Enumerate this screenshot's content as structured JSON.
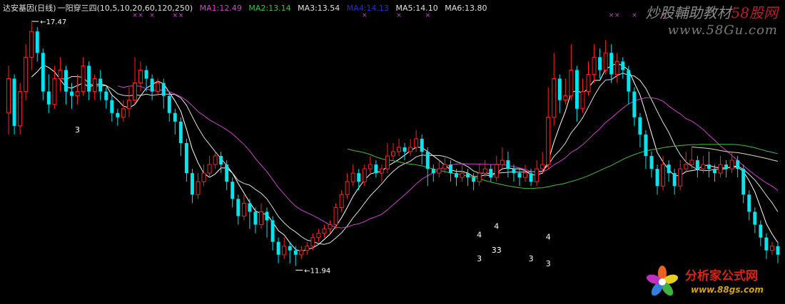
{
  "header": {
    "title": "达安基因(日线)",
    "formula": "一阳穿三四(10,5,10,20,60,120,250)",
    "ma": [
      {
        "label": "MA1:12.49",
        "color": "#d040d0"
      },
      {
        "label": "MA2:13.14",
        "color": "#40c040"
      },
      {
        "label": "MA3:13.54",
        "color": "#e0e0e0"
      },
      {
        "label": "MA4:14.13",
        "color": "#2a2ae0"
      },
      {
        "label": "MA5:14.10",
        "color": "#e0e0e0"
      },
      {
        "label": "MA6:13.80",
        "color": "#e0e0e0"
      }
    ]
  },
  "watermark": {
    "line1_text": "炒股輔助教材",
    "line1_num": "58股网",
    "line2": "www.58Gu.com"
  },
  "logo": {
    "text": "分析家公式网",
    "url": "www.88gs.com"
  },
  "chart_data": {
    "type": "candlestick",
    "title": "达安基因(日线)",
    "ylim": [
      11.5,
      17.8
    ],
    "colors": {
      "up": "#ff2020",
      "down": "#00e5ee",
      "signal": "#d040d0",
      "marker": "#ffffff"
    },
    "annotations": [
      {
        "label": "17.47",
        "candle": 4
      },
      {
        "label": "11.94",
        "candle": 50
      }
    ],
    "signals": [
      22,
      23,
      25,
      29,
      30,
      62,
      68,
      73,
      105,
      106,
      109,
      114
    ],
    "text_markers": [
      {
        "text": "3",
        "candle": 12,
        "price": 15.05
      },
      {
        "text": "4",
        "candle": 82,
        "price": 12.6
      },
      {
        "text": "3",
        "candle": 82,
        "price": 12.05
      },
      {
        "text": "4",
        "candle": 85,
        "price": 12.8
      },
      {
        "text": "33",
        "candle": 85,
        "price": 12.25
      },
      {
        "text": "3",
        "candle": 91,
        "price": 12.05
      },
      {
        "text": "4",
        "candle": 94,
        "price": 12.55
      },
      {
        "text": "3",
        "candle": 94,
        "price": 11.93
      }
    ],
    "candles": [
      [
        15.5,
        16.3,
        16.6,
        15.0
      ],
      [
        16.3,
        15.2,
        16.4,
        15.0
      ],
      [
        15.2,
        16.0,
        16.2,
        15.0
      ],
      [
        16.0,
        16.8,
        17.1,
        15.8
      ],
      [
        16.8,
        17.4,
        17.6,
        16.5
      ],
      [
        17.4,
        16.9,
        17.5,
        16.7
      ],
      [
        16.9,
        16.0,
        17.0,
        15.8
      ],
      [
        16.0,
        15.7,
        16.4,
        15.5
      ],
      [
        15.7,
        16.3,
        16.6,
        15.6
      ],
      [
        16.3,
        16.5,
        16.8,
        16.0
      ],
      [
        16.5,
        16.0,
        16.6,
        15.7
      ],
      [
        16.0,
        15.9,
        16.2,
        15.6
      ],
      [
        15.9,
        16.0,
        16.4,
        15.7
      ],
      [
        16.0,
        16.6,
        16.8,
        15.9
      ],
      [
        16.6,
        16.0,
        16.7,
        15.8
      ],
      [
        16.0,
        16.3,
        16.4,
        15.8
      ],
      [
        16.3,
        16.0,
        16.5,
        15.8
      ],
      [
        16.0,
        15.8,
        16.1,
        15.6
      ],
      [
        15.8,
        15.5,
        15.9,
        15.3
      ],
      [
        15.5,
        15.4,
        15.6,
        15.2
      ],
      [
        15.4,
        15.6,
        15.8,
        15.3
      ],
      [
        15.6,
        15.8,
        16.1,
        15.4
      ],
      [
        15.8,
        16.2,
        16.8,
        15.7
      ],
      [
        16.2,
        16.5,
        16.7,
        16.0
      ],
      [
        16.5,
        16.3,
        16.6,
        16.0
      ],
      [
        16.3,
        16.0,
        16.4,
        15.8
      ],
      [
        16.0,
        16.2,
        16.3,
        15.9
      ],
      [
        16.2,
        15.9,
        16.3,
        15.6
      ],
      [
        15.9,
        15.5,
        16.0,
        15.3
      ],
      [
        15.5,
        15.3,
        15.6,
        15.0
      ],
      [
        15.3,
        14.8,
        15.4,
        14.5
      ],
      [
        14.8,
        14.1,
        14.9,
        13.9
      ],
      [
        14.1,
        13.6,
        14.2,
        13.4
      ],
      [
        13.6,
        13.9,
        14.1,
        13.5
      ],
      [
        13.9,
        14.1,
        14.3,
        13.8
      ],
      [
        14.1,
        14.3,
        14.5,
        14.0
      ],
      [
        14.3,
        14.5,
        14.6,
        14.2
      ],
      [
        14.5,
        14.3,
        14.6,
        14.1
      ],
      [
        14.3,
        13.9,
        14.4,
        13.7
      ],
      [
        13.9,
        13.5,
        14.0,
        13.3
      ],
      [
        13.5,
        13.1,
        13.6,
        12.9
      ],
      [
        13.1,
        13.4,
        13.6,
        13.0
      ],
      [
        13.4,
        13.2,
        13.5,
        12.8
      ],
      [
        13.2,
        12.9,
        13.3,
        12.7
      ],
      [
        12.9,
        13.2,
        13.4,
        12.8
      ],
      [
        13.2,
        13.0,
        13.3,
        12.6
      ],
      [
        13.0,
        12.5,
        13.1,
        12.3
      ],
      [
        12.5,
        12.2,
        12.6,
        12.0
      ],
      [
        12.2,
        12.4,
        12.6,
        12.1
      ],
      [
        12.4,
        12.3,
        12.5,
        12.0
      ],
      [
        12.3,
        12.2,
        12.4,
        11.94
      ],
      [
        12.2,
        12.3,
        12.4,
        12.1
      ],
      [
        12.3,
        12.4,
        12.5,
        12.2
      ],
      [
        12.4,
        12.6,
        12.7,
        12.3
      ],
      [
        12.6,
        12.7,
        12.8,
        12.5
      ],
      [
        12.7,
        12.8,
        12.9,
        12.6
      ],
      [
        12.8,
        12.9,
        13.0,
        12.7
      ],
      [
        12.9,
        13.3,
        13.4,
        12.8
      ],
      [
        13.3,
        13.6,
        13.7,
        13.2
      ],
      [
        13.6,
        13.9,
        14.1,
        13.5
      ],
      [
        13.9,
        14.1,
        14.3,
        13.8
      ],
      [
        14.1,
        13.9,
        14.2,
        13.7
      ],
      [
        13.9,
        14.2,
        14.3,
        13.8
      ],
      [
        14.2,
        14.3,
        14.5,
        14.1
      ],
      [
        14.3,
        14.1,
        14.4,
        14.0
      ],
      [
        14.1,
        14.2,
        14.3,
        13.9
      ],
      [
        14.2,
        14.5,
        14.8,
        14.1
      ],
      [
        14.5,
        14.6,
        14.8,
        14.4
      ],
      [
        14.6,
        14.7,
        14.9,
        14.5
      ],
      [
        14.7,
        14.6,
        14.8,
        14.4
      ],
      [
        14.6,
        14.7,
        14.9,
        14.5
      ],
      [
        14.7,
        14.9,
        15.1,
        14.6
      ],
      [
        14.9,
        14.6,
        15.0,
        14.3
      ],
      [
        14.6,
        14.2,
        14.7,
        13.8
      ],
      [
        14.2,
        14.1,
        14.3,
        13.9
      ],
      [
        14.1,
        14.2,
        14.4,
        14.0
      ],
      [
        14.2,
        14.3,
        14.5,
        14.1
      ],
      [
        14.3,
        14.1,
        14.4,
        13.9
      ],
      [
        14.1,
        14.0,
        14.2,
        13.8
      ],
      [
        14.0,
        14.1,
        14.3,
        13.9
      ],
      [
        14.1,
        14.0,
        14.2,
        13.8
      ],
      [
        14.0,
        13.9,
        14.1,
        13.7
      ],
      [
        13.9,
        14.1,
        14.3,
        13.8
      ],
      [
        14.1,
        14.2,
        14.4,
        14.0
      ],
      [
        14.2,
        14.0,
        14.3,
        13.9
      ],
      [
        14.0,
        14.3,
        14.5,
        13.9
      ],
      [
        14.3,
        14.4,
        14.7,
        14.2
      ],
      [
        14.4,
        14.2,
        14.6,
        14.0
      ],
      [
        14.2,
        14.1,
        14.3,
        13.9
      ],
      [
        14.1,
        14.0,
        14.2,
        13.8
      ],
      [
        14.0,
        14.1,
        14.3,
        13.9
      ],
      [
        14.1,
        13.9,
        14.2,
        13.8
      ],
      [
        13.9,
        14.2,
        14.4,
        13.8
      ],
      [
        14.2,
        14.3,
        14.6,
        14.1
      ],
      [
        14.3,
        15.4,
        16.1,
        14.2
      ],
      [
        15.4,
        16.3,
        16.9,
        15.2
      ],
      [
        16.3,
        15.8,
        16.4,
        15.5
      ],
      [
        15.8,
        15.9,
        16.3,
        15.7
      ],
      [
        15.9,
        16.5,
        17.1,
        15.8
      ],
      [
        16.5,
        15.6,
        16.6,
        15.3
      ],
      [
        15.6,
        16.0,
        16.3,
        15.5
      ],
      [
        16.0,
        16.4,
        16.7,
        15.9
      ],
      [
        16.4,
        16.8,
        17.1,
        16.2
      ],
      [
        16.8,
        16.5,
        17.0,
        16.3
      ],
      [
        16.5,
        16.9,
        17.2,
        16.4
      ],
      [
        16.9,
        16.4,
        17.1,
        16.2
      ],
      [
        16.4,
        16.7,
        16.9,
        16.2
      ],
      [
        16.7,
        16.5,
        16.8,
        16.3
      ],
      [
        16.5,
        16.0,
        16.6,
        15.7
      ],
      [
        16.0,
        15.4,
        16.1,
        15.2
      ],
      [
        15.4,
        15.0,
        15.5,
        14.7
      ],
      [
        15.0,
        14.5,
        15.1,
        14.2
      ],
      [
        14.5,
        14.2,
        14.6,
        14.0
      ],
      [
        14.2,
        13.8,
        14.3,
        13.6
      ],
      [
        13.8,
        14.3,
        14.5,
        13.7
      ],
      [
        14.3,
        14.1,
        14.4,
        13.9
      ],
      [
        14.1,
        13.8,
        14.2,
        13.6
      ],
      [
        13.8,
        14.2,
        14.4,
        13.7
      ],
      [
        14.2,
        14.3,
        14.6,
        14.1
      ],
      [
        14.3,
        14.4,
        14.7,
        14.2
      ],
      [
        14.4,
        14.2,
        14.5,
        14.0
      ],
      [
        14.2,
        14.3,
        14.5,
        14.1
      ],
      [
        14.3,
        14.2,
        14.6,
        14.0
      ],
      [
        14.2,
        14.1,
        14.3,
        13.9
      ],
      [
        14.1,
        14.3,
        14.5,
        14.0
      ],
      [
        14.3,
        14.2,
        14.4,
        14.0
      ],
      [
        14.2,
        14.4,
        14.6,
        14.1
      ],
      [
        14.4,
        14.2,
        14.5,
        14.0
      ],
      [
        14.2,
        13.6,
        14.3,
        13.4
      ],
      [
        13.6,
        13.2,
        13.7,
        13.0
      ],
      [
        13.2,
        12.9,
        13.3,
        12.7
      ],
      [
        12.9,
        12.6,
        13.0,
        12.4
      ],
      [
        12.6,
        12.3,
        12.7,
        12.1
      ],
      [
        12.3,
        12.4,
        12.5,
        12.2
      ],
      [
        12.4,
        12.2,
        12.5,
        12.0
      ]
    ]
  }
}
